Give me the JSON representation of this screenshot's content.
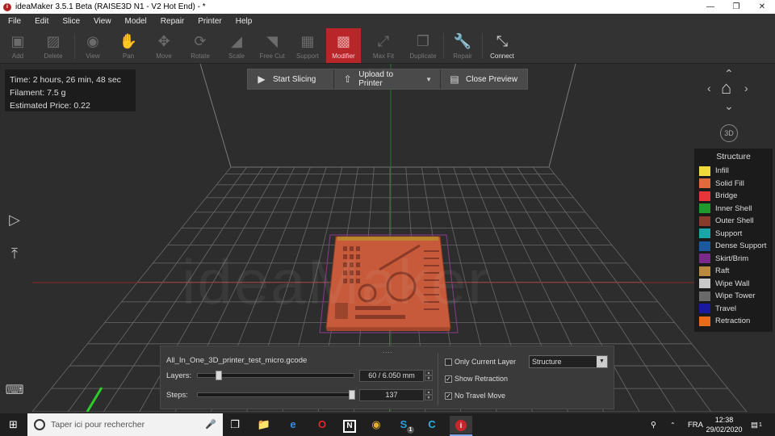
{
  "window": {
    "title": "ideaMaker 3.5.1 Beta (RAISE3D N1 - V2 Hot End) - *",
    "app_icon": "ideamaker-logo",
    "app_icon_glyph": "i",
    "controls": [
      "minimize-icon",
      "restore-icon",
      "close-icon"
    ]
  },
  "menu": [
    "File",
    "Edit",
    "Slice",
    "View",
    "Model",
    "Repair",
    "Printer",
    "Help"
  ],
  "toolbar": {
    "items": [
      {
        "label": "Add",
        "icon": "add-cube-icon",
        "state": "disabled"
      },
      {
        "label": "Delete",
        "icon": "delete-cube-icon",
        "state": "disabled"
      },
      {
        "label": "View",
        "icon": "eye-icon",
        "state": "disabled"
      },
      {
        "label": "Pan",
        "icon": "pan-hand-icon",
        "state": "disabled"
      },
      {
        "label": "Move",
        "icon": "move-arrows-icon",
        "state": "disabled"
      },
      {
        "label": "Rotate",
        "icon": "rotate-icon",
        "state": "disabled"
      },
      {
        "label": "Scale",
        "icon": "scale-icon",
        "state": "disabled"
      },
      {
        "label": "Free Cut",
        "icon": "free-cut-icon",
        "state": "disabled"
      },
      {
        "label": "Support",
        "icon": "support-icon",
        "state": "disabled"
      },
      {
        "label": "Modifier",
        "icon": "modifier-icon",
        "state": "active"
      },
      {
        "label": "Max Fit",
        "icon": "max-fit-icon",
        "state": "disabled"
      },
      {
        "label": "Duplicate",
        "icon": "duplicate-icon",
        "state": "disabled"
      },
      {
        "label": "Repair",
        "icon": "repair-wrench-icon",
        "state": "disabled"
      },
      {
        "label": "Connect",
        "icon": "connect-icon",
        "state": "enabled"
      }
    ]
  },
  "info": {
    "time": "Time: 2 hours, 26 min, 48 sec",
    "filament": "Filament: 7.5 g",
    "price": "Estimated Price: 0.22"
  },
  "actions": {
    "start_slicing": "Start Slicing",
    "upload": "Upload to Printer",
    "close_preview": "Close Preview"
  },
  "viewport": {
    "watermark": "ideaMaker",
    "nav_3d_label": "3D"
  },
  "legend": {
    "title": "Structure",
    "items": [
      {
        "label": "Infill",
        "color": "#f0d93a"
      },
      {
        "label": "Solid Fill",
        "color": "#e06a3a"
      },
      {
        "label": "Bridge",
        "color": "#e8353a"
      },
      {
        "label": "Inner Shell",
        "color": "#1f9a2a"
      },
      {
        "label": "Outer Shell",
        "color": "#8a3a2a"
      },
      {
        "label": "Support",
        "color": "#1aa5a8"
      },
      {
        "label": "Dense Support",
        "color": "#1a5aa0"
      },
      {
        "label": "Skirt/Brim",
        "color": "#7a2a8a"
      },
      {
        "label": "Raft",
        "color": "#b88a3a"
      },
      {
        "label": "Wipe Wall",
        "color": "#c8c8c8"
      },
      {
        "label": "Wipe Tower",
        "color": "#6a6a6a"
      },
      {
        "label": "Travel",
        "color": "#1a1aa0"
      },
      {
        "label": "Retraction",
        "color": "#e86a1a"
      }
    ]
  },
  "slicer_panel": {
    "filename": "All_In_One_3D_printer_test_micro.gcode",
    "layers_label": "Layers:",
    "layers_value": "60 / 6.050 mm",
    "layers_fraction": 0.12,
    "steps_label": "Steps:",
    "steps_value": "137",
    "steps_fraction": 1.0,
    "only_current_layer": {
      "label": "Only Current Layer",
      "checked": false
    },
    "show_retraction": {
      "label": "Show Retraction",
      "checked": true
    },
    "no_travel_move": {
      "label": "No Travel Move",
      "checked": true
    },
    "view_mode": "Structure"
  },
  "taskbar": {
    "search_placeholder": "Taper ici pour rechercher",
    "apps": [
      "task-view-icon",
      "file-explorer-icon",
      "edge-icon",
      "opera-icon",
      "app-n-icon",
      "chrome-icon",
      "skype-icon",
      "ccleaner-icon",
      "ideamaker-icon"
    ],
    "skype_badge": "1",
    "language": "FRA",
    "time": "12:38",
    "date": "29/02/2020",
    "notifications": "1"
  }
}
